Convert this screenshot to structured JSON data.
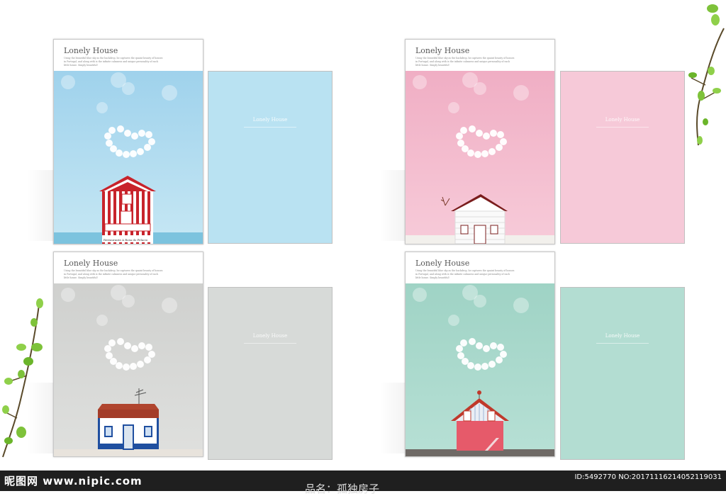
{
  "covers": [
    {
      "title": "Lonely House",
      "desc": "Using the beautiful blue sky as the backdrop, he captures the quaint beauty of houses in Portugal, and along with is the infinite calmness and unique personality of each little house. Simply beautiful!",
      "back_title": "Lonely House",
      "bg": "#b6dff0",
      "back_bg": "#b9e2f2",
      "sign": "Restaurante A Rosa do Pelacio"
    },
    {
      "title": "Lonely House",
      "desc": "Using the beautiful blue sky as the backdrop, he captures the quaint beauty of houses in Portugal, and along with is the infinite calmness and unique personality of each little house. Simply beautiful!",
      "back_title": "Lonely House",
      "bg": "#f3bfd0",
      "back_bg": "#f6c9d8"
    },
    {
      "title": "Lonely House",
      "desc": "Using the beautiful blue sky as the backdrop, he captures the quaint beauty of houses in Portugal, and along with is the infinite calmness and unique personality of each little house. Simply beautiful!",
      "back_title": "Lonely House",
      "bg": "#d6d7d5",
      "back_bg": "#d7dad8"
    },
    {
      "title": "Lonely House",
      "desc": "Using the beautiful blue sky as the backdrop, he captures the quaint beauty of houses in Portugal, and along with is the infinite calmness and unique personality of each little house. Simply beautiful!",
      "back_title": "Lonely House",
      "bg": "#aad8cc",
      "back_bg": "#b3ddd2"
    }
  ],
  "footer": {
    "logo": "昵图网 www.nipic.com",
    "id_text": "ID:5492770 NO:20171116214052119031",
    "name_text": "品名：孤独房子"
  }
}
